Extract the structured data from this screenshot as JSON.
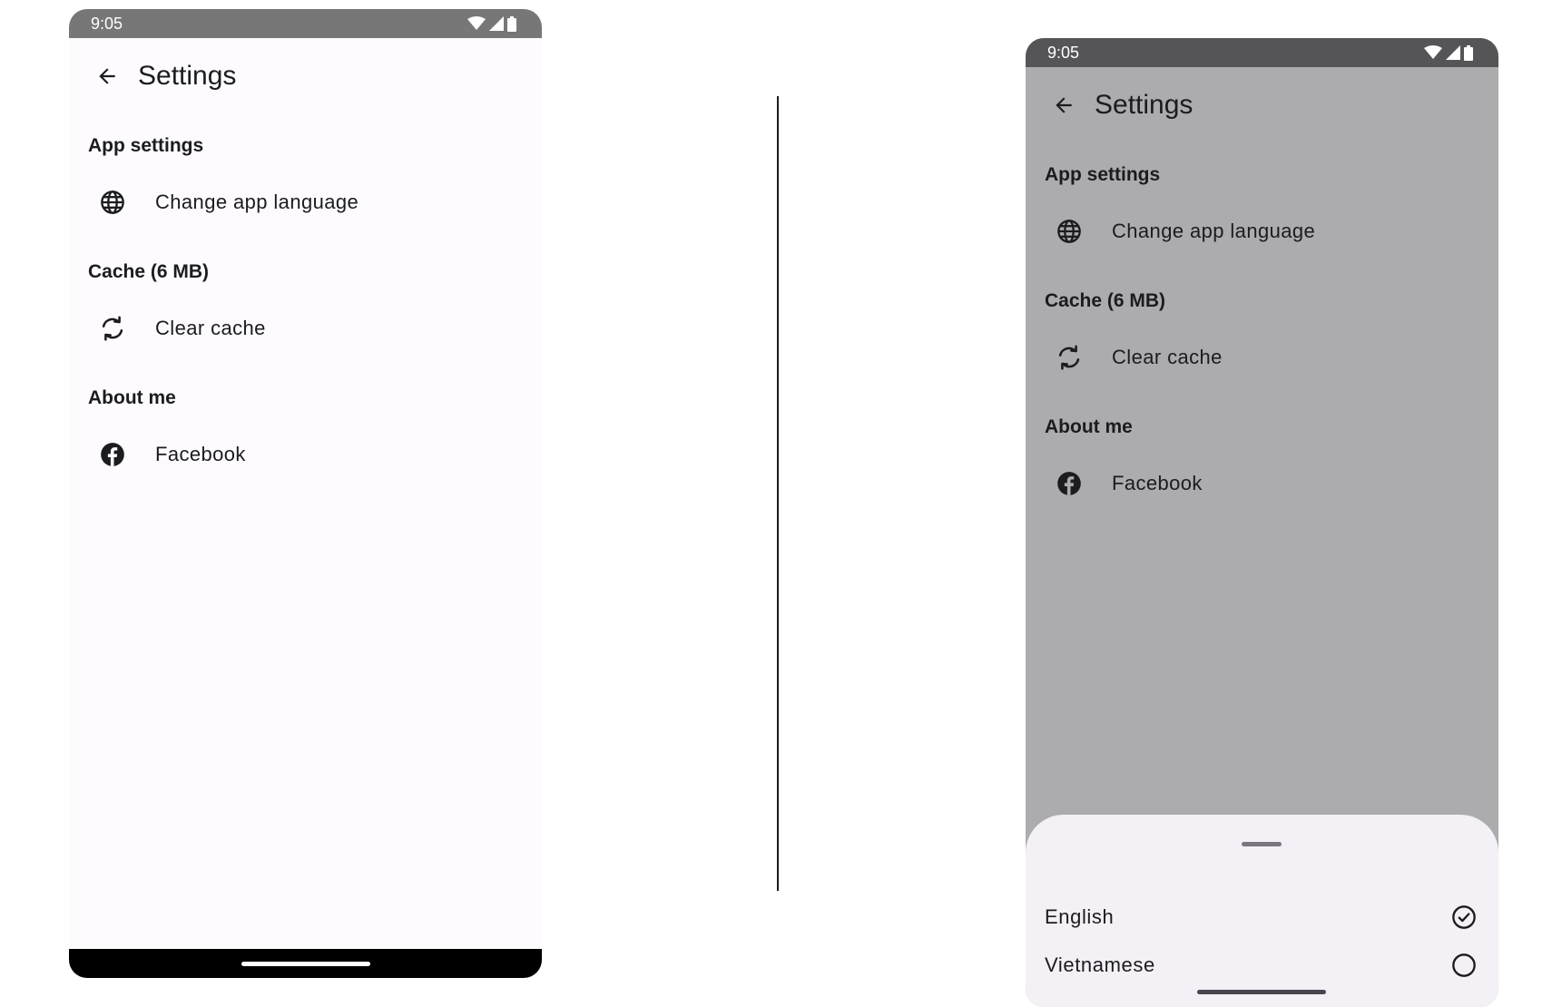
{
  "left_screen": {
    "status_bar": {
      "time": "9:05"
    },
    "top_bar": {
      "title": "Settings"
    },
    "sections": [
      {
        "header": "App settings",
        "item": {
          "label": "Change app language",
          "icon": "globe-icon"
        }
      },
      {
        "header": "Cache (6 MB)",
        "item": {
          "label": "Clear cache",
          "icon": "refresh-icon"
        }
      },
      {
        "header": "About me",
        "item": {
          "label": "Facebook",
          "icon": "facebook-icon"
        }
      }
    ]
  },
  "right_screen": {
    "status_bar": {
      "time": "9:05"
    },
    "top_bar": {
      "title": "Settings"
    },
    "sections": [
      {
        "header": "App settings",
        "item": {
          "label": "Change app language",
          "icon": "globe-icon"
        }
      },
      {
        "header": "Cache (6 MB)",
        "item": {
          "label": "Clear cache",
          "icon": "refresh-icon"
        }
      },
      {
        "header": "About me",
        "item": {
          "label": "Facebook",
          "icon": "facebook-icon"
        }
      }
    ],
    "language_sheet": {
      "options": [
        {
          "label": "English",
          "selected": true
        },
        {
          "label": "Vietnamese",
          "selected": false
        }
      ]
    }
  },
  "colors": {
    "screen_background": "#fdfbfe",
    "scrim_background": "#acabae",
    "sheet_background": "#f3f0f6",
    "text_primary": "#1c1b1f",
    "status_bar": "#777777",
    "nav_bar": "#000000"
  }
}
